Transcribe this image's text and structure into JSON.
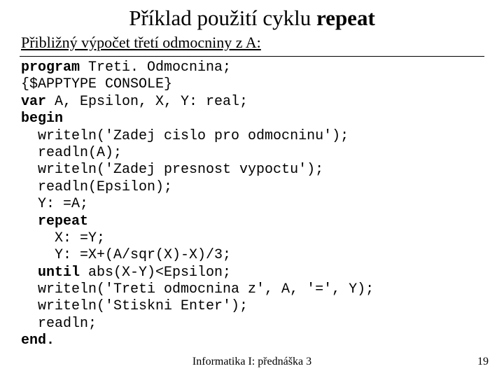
{
  "title_pre": "Příklad použití cyklu ",
  "title_kw": "repeat",
  "subtitle": "Přibližný výpočet třetí odmocniny z A:",
  "code": {
    "l1a": "program",
    "l1b": " Treti. Odmocnina;",
    "l2": "{$APPTYPE CONSOLE}",
    "l3a": "var",
    "l3b": " A, Epsilon, X, Y: real;",
    "l4": "begin",
    "l5": "  writeln('Zadej cislo pro odmocninu');",
    "l6": "  readln(A);",
    "l7": "  writeln('Zadej presnost vypoctu');",
    "l8": "  readln(Epsilon);",
    "l9": "  Y: =A;",
    "l10": "  repeat",
    "l11": "    X: =Y;",
    "l12": "    Y: =X+(A/sqr(X)-X)/3;",
    "l13a": "  until",
    "l13b": " abs(X-Y)<Epsilon;",
    "l14": "  writeln('Treti odmocnina z', A, '=', Y);",
    "l15": "  writeln('Stiskni Enter');",
    "l16": "  readln;",
    "l17": "end."
  },
  "footer_center": "Informatika I: přednáška 3",
  "footer_num": "19"
}
